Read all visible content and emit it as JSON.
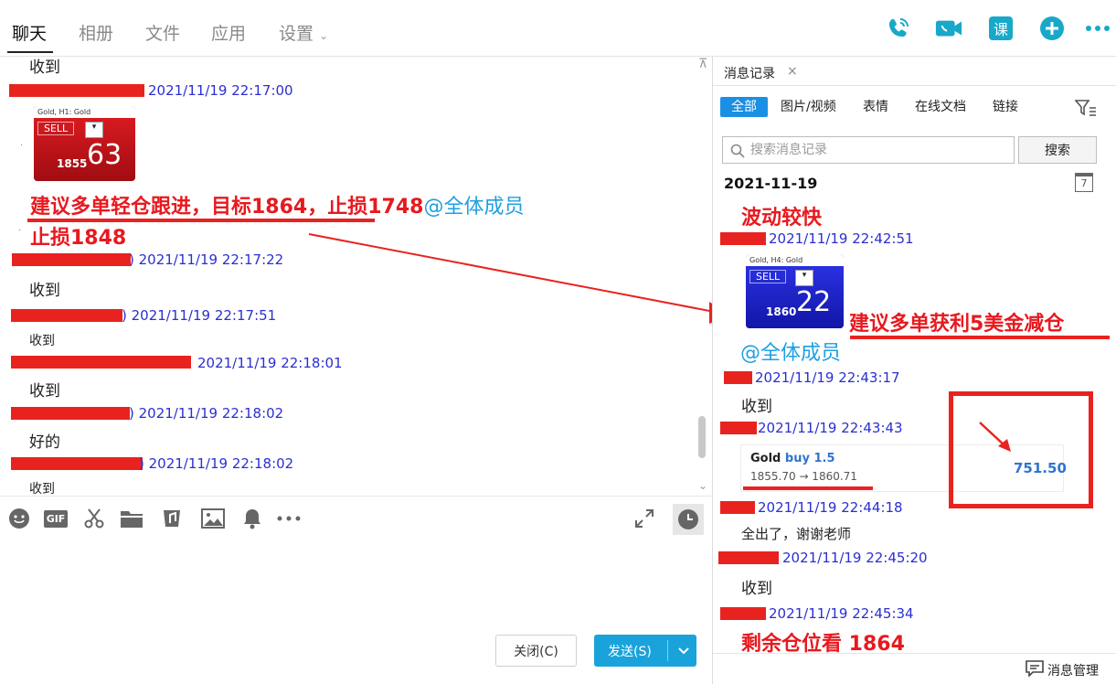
{
  "nav": {
    "tabs": [
      {
        "label": "聊天",
        "active": true
      },
      {
        "label": "相册",
        "active": false
      },
      {
        "label": "文件",
        "active": false
      },
      {
        "label": "应用",
        "active": false
      },
      {
        "label": "设置",
        "active": false
      }
    ],
    "course_label": "课",
    "icons": [
      "phone-icon",
      "video-icon",
      "course-icon",
      "add-icon",
      "more-icon"
    ]
  },
  "chat": {
    "messages": [
      {
        "kind": "text",
        "text": "收到"
      },
      {
        "kind": "timestamp",
        "text": "2021/11/19 22:17:00"
      },
      {
        "kind": "trade_card",
        "header": "Gold, H1:  Gold",
        "action": "SELL",
        "small": "1855",
        "big": "63"
      },
      {
        "kind": "announcement",
        "text": "建议多单轻仓跟进，目标1864，止损1748",
        "mention": "@全体成员",
        "text2": "止损1848"
      },
      {
        "kind": "timestamp",
        "text": ") 2021/11/19 22:17:22"
      },
      {
        "kind": "text",
        "text": "收到"
      },
      {
        "kind": "timestamp",
        "text": ") 2021/11/19 22:17:51"
      },
      {
        "kind": "text",
        "text": "收到"
      },
      {
        "kind": "timestamp",
        "text": "2021/11/19 22:18:01"
      },
      {
        "kind": "text",
        "text": "收到"
      },
      {
        "kind": "timestamp",
        "text": ") 2021/11/19 22:18:02"
      },
      {
        "kind": "text",
        "text": "好的"
      },
      {
        "kind": "timestamp",
        "text": ") 2021/11/19 22:18:02"
      },
      {
        "kind": "text",
        "text": "收到"
      }
    ]
  },
  "composer": {
    "close_label": "关闭(C)",
    "send_label": "发送(S)",
    "toolbar_icons": [
      "emoji-icon",
      "gif-icon",
      "scissors-icon",
      "folder-icon",
      "music-icon",
      "image-icon",
      "bell-icon",
      "more-icon"
    ]
  },
  "history": {
    "tab_label": "消息记录",
    "tab_close": "×",
    "filters": [
      {
        "label": "全部",
        "active": true
      },
      {
        "label": "图片/视频",
        "active": false
      },
      {
        "label": "表情",
        "active": false
      },
      {
        "label": "在线文档",
        "active": false
      },
      {
        "label": "链接",
        "active": false
      }
    ],
    "search": {
      "placeholder": "搜索消息记录",
      "button": "搜索"
    },
    "date": "2021-11-19",
    "calendar_day": "7",
    "messages": [
      {
        "kind": "announcement",
        "text": "波动较快"
      },
      {
        "kind": "timestamp",
        "text": "2021/11/19 22:42:51"
      },
      {
        "kind": "trade_card",
        "header": "Gold, H4:  Gold",
        "action": "SELL",
        "small": "1860",
        "big": "22"
      },
      {
        "kind": "announcement",
        "text": "建议多单获利5美金减仓",
        "mention": "@全体成员"
      },
      {
        "kind": "timestamp",
        "text": "2021/11/19 22:43:17"
      },
      {
        "kind": "text",
        "text": "收到"
      },
      {
        "kind": "timestamp",
        "text": "2021/11/19 22:43:43"
      },
      {
        "kind": "profit_card",
        "symbol": "Gold",
        "side": "buy 1.5",
        "prices": "1855.70 → 1860.71",
        "profit": "751.50"
      },
      {
        "kind": "timestamp",
        "text": "2021/11/19 22:44:18"
      },
      {
        "kind": "text",
        "text": "全出了，谢谢老师"
      },
      {
        "kind": "timestamp",
        "text": "2021/11/19 22:45:20"
      },
      {
        "kind": "text",
        "text": "收到"
      },
      {
        "kind": "timestamp",
        "text": "2021/11/19 22:45:34"
      },
      {
        "kind": "announcement",
        "text": "剩余仓位看  1864"
      }
    ],
    "footer_label": "消息管理"
  },
  "colors": {
    "accent": "#1aa3db",
    "annotation_red": "#e8231f",
    "timestamp_blue": "#2b2fd0",
    "mention_blue": "#1ea0e0",
    "sell_red": "#c8141b",
    "sell_blue": "#1d22c9",
    "profit_blue": "#2f74d0"
  }
}
